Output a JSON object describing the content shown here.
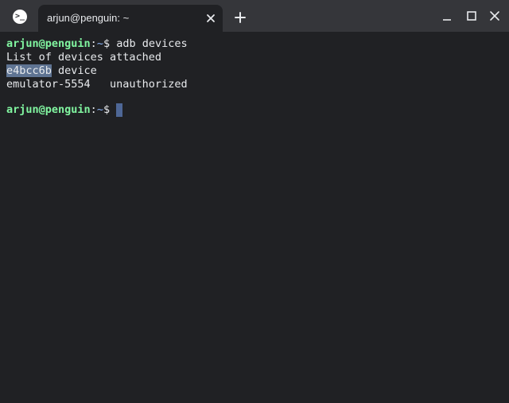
{
  "titlebar": {
    "app_icon_glyph": ">_",
    "tab_title": "arjun@penguin: ~",
    "new_tab_glyph": "+"
  },
  "terminal": {
    "lines": [
      {
        "user": "arjun@penguin",
        "sep": ":",
        "path": "~",
        "prompt_end": "$ ",
        "command": "adb devices"
      },
      {
        "text": "List of devices attached"
      },
      {
        "device_id": "e4bcc6b",
        "status": " device"
      },
      {
        "text": "emulator-5554   unauthorized"
      },
      {
        "user": "arjun@penguin",
        "sep": ":",
        "path": "~",
        "prompt_end": "$ "
      }
    ]
  },
  "colors": {
    "titlebar_bg": "#35363a",
    "terminal_bg": "#202124",
    "prompt_user": "#81f5a0",
    "text": "#e8eaed",
    "selection": "#5f7493",
    "cursor": "#4e6796"
  },
  "icons": {
    "app": "terminal-icon",
    "tab_close": "close-icon",
    "new_tab": "plus-icon",
    "minimize": "minimize-icon",
    "maximize": "maximize-icon",
    "close": "close-icon"
  }
}
